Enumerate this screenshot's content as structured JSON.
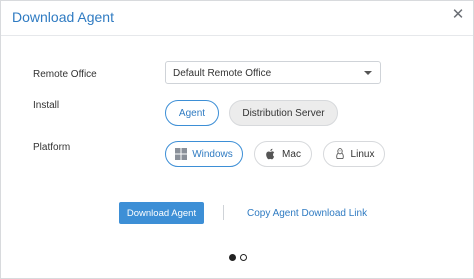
{
  "dialog": {
    "title": "Download Agent",
    "close_icon": "close-icon"
  },
  "form": {
    "remote_office": {
      "label": "Remote Office",
      "selected": "Default Remote Office"
    },
    "install": {
      "label": "Install",
      "options": [
        {
          "label": "Agent",
          "selected": true
        },
        {
          "label": "Distribution Server",
          "selected": false
        }
      ]
    },
    "platform": {
      "label": "Platform",
      "options": [
        {
          "label": "Windows",
          "icon": "windows-icon",
          "selected": true
        },
        {
          "label": "Mac",
          "icon": "apple-icon",
          "selected": false
        },
        {
          "label": "Linux",
          "icon": "linux-icon",
          "selected": false
        }
      ]
    }
  },
  "actions": {
    "download_label": "Download Agent",
    "copy_link_label": "Copy Agent Download Link"
  },
  "pager": {
    "current_page": 1,
    "total_pages": 2
  },
  "colors": {
    "accent": "#3d8fd6",
    "title": "#2f7bc2"
  }
}
